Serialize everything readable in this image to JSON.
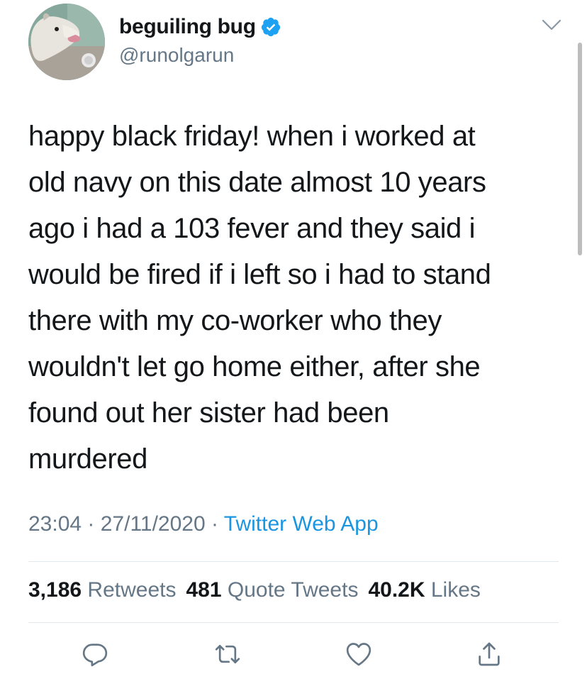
{
  "tweet": {
    "author": {
      "display_name": "beguiling bug",
      "handle": "@runolgarun",
      "verified": true,
      "avatar_icon": "opossum-avatar"
    },
    "text": "happy black friday! when i worked at\nold navy on this date almost 10 years\nago i had a 103 fever and they said i\nwould be fired if i left so i had to stand\nthere with my co-worker who they\nwouldn't let go home either, after she\nfound out her sister had been\nmurdered",
    "time": "23:04",
    "separator": " · ",
    "date": "27/11/2020",
    "source": "Twitter Web App",
    "stats": {
      "retweets_count": "3,186",
      "retweets_label": "Retweets",
      "quote_tweets_count": "481",
      "quote_tweets_label": "Quote Tweets",
      "likes_count": "40.2K",
      "likes_label": "Likes"
    }
  },
  "icons": {
    "menu": "chevron-down-icon",
    "verified": "verified-badge-icon",
    "reply": "reply-icon",
    "retweet": "retweet-icon",
    "like": "heart-icon",
    "share": "share-icon"
  },
  "colors": {
    "text": "#14171a",
    "secondary": "#657786",
    "accent": "#1b95e0",
    "verified": "#1da1f2",
    "divider": "#e1e8ed"
  }
}
